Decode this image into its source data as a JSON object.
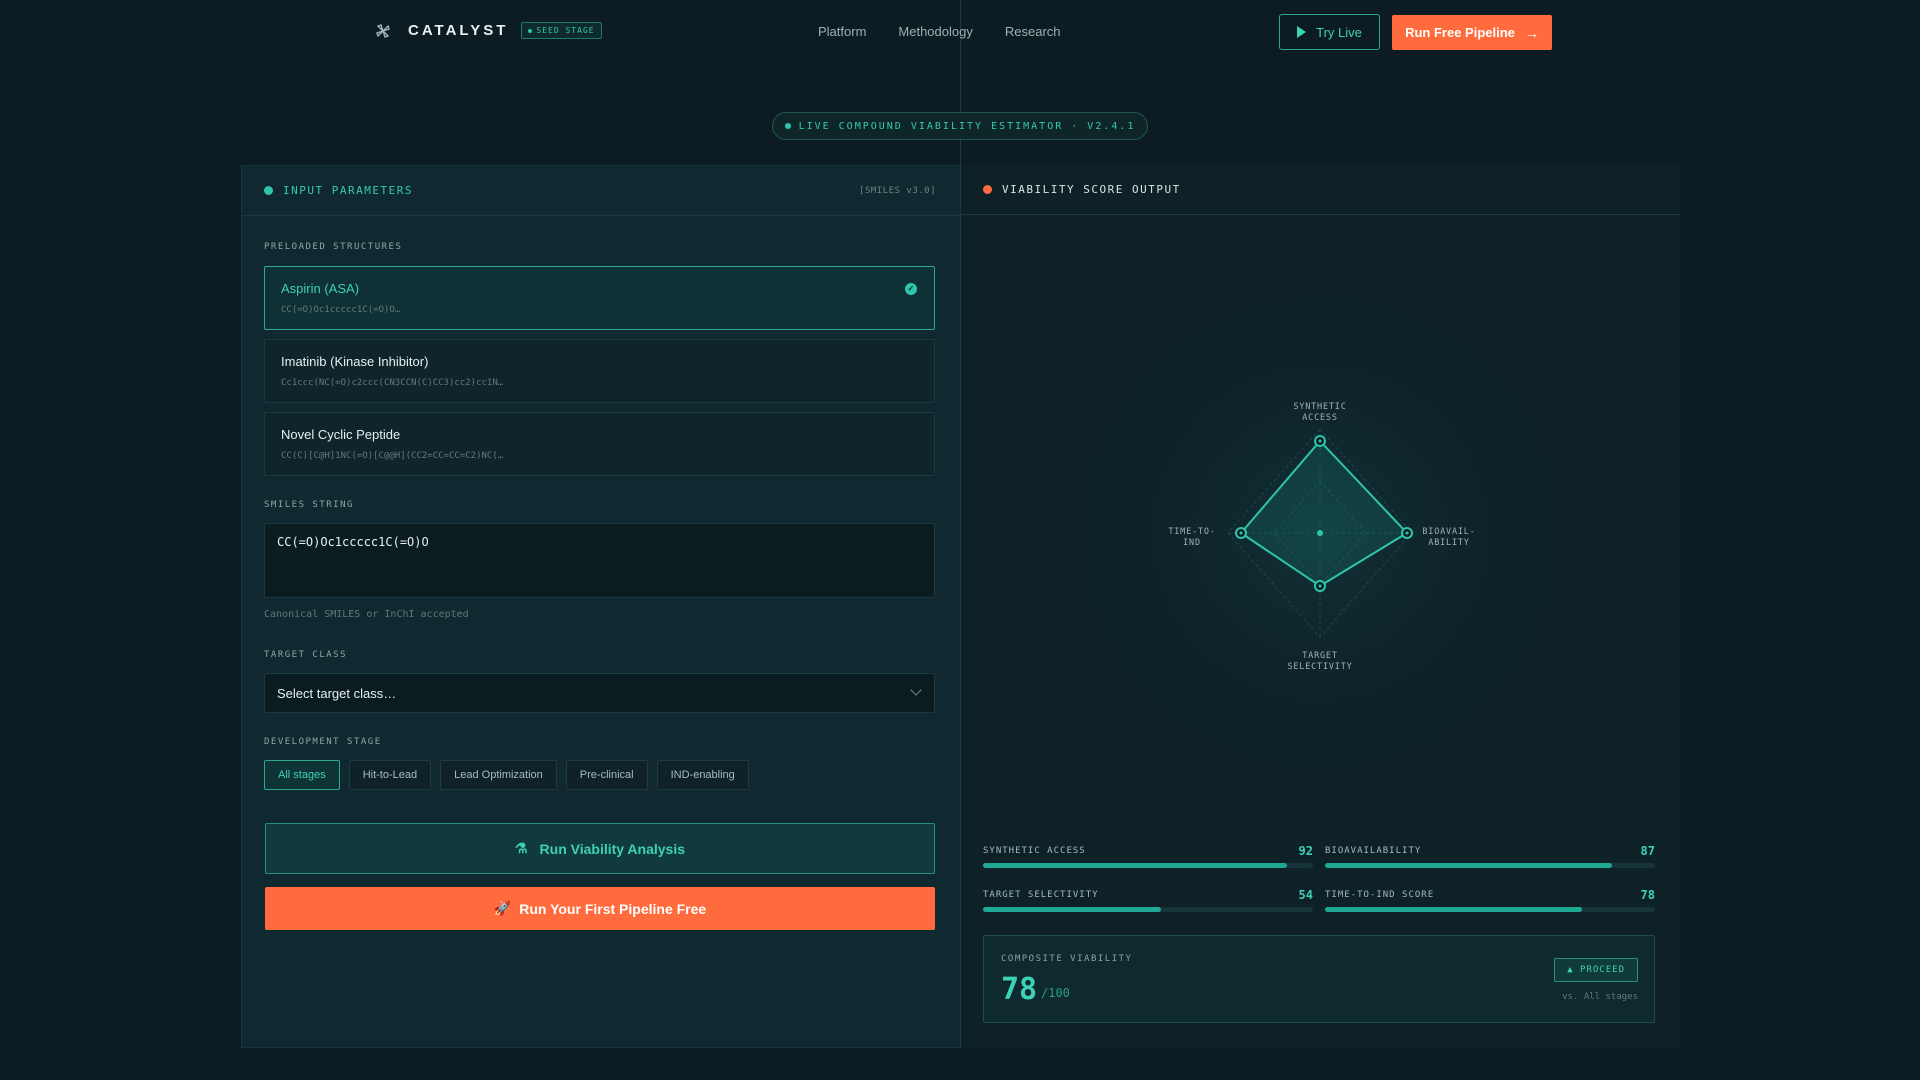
{
  "nav": {
    "brand": "CATALYST",
    "badge": "SEED STAGE",
    "links": [
      "Platform",
      "Methodology",
      "Research"
    ],
    "try_label": "Try Live",
    "run_label": "Run Free Pipeline"
  },
  "hero": {
    "pill": "LIVE COMPOUND VIABILITY ESTIMATOR · V2.4.1"
  },
  "input_panel": {
    "title": "INPUT PARAMETERS",
    "version": "[SMILES v3.0]",
    "preloaded_label": "PRELOADED STRUCTURES",
    "structures": [
      {
        "name": "Aspirin (ASA)",
        "smiles": "CC(=O)Oc1ccccc1C(=O)O…",
        "selected": true
      },
      {
        "name": "Imatinib (Kinase Inhibitor)",
        "smiles": "Cc1ccc(NC(=O)c2ccc(CN3CCN(C)CC3)cc2)cc1N…",
        "selected": false
      },
      {
        "name": "Novel Cyclic Peptide",
        "smiles": "CC(C)[C@H]1NC(=O)[C@@H](CC2=CC=CC=C2)NC(…",
        "selected": false
      }
    ],
    "smiles_label": "SMILES STRING",
    "smiles_value": "CC(=O)Oc1ccccc1C(=O)O",
    "smiles_hint": "Canonical SMILES or InChI accepted",
    "target_label": "TARGET CLASS",
    "target_placeholder": "Select target class…",
    "stage_label": "DEVELOPMENT STAGE",
    "stages": [
      "All stages",
      "Hit-to-Lead",
      "Lead Optimization",
      "Pre-clinical",
      "IND-enabling"
    ],
    "active_stage": "All stages",
    "analyze_label": "Run Viability Analysis",
    "pipeline_label": "Run Your First Pipeline Free"
  },
  "output_panel": {
    "title": "VIABILITY SCORE OUTPUT",
    "radar_axes": {
      "top": [
        "SYNTHETIC",
        "ACCESS"
      ],
      "right": [
        "BIOAVAIL-",
        "ABILITY"
      ],
      "bottom": [
        "TARGET",
        "SELECTIVITY"
      ],
      "left": [
        "TIME-TO-",
        "IND"
      ]
    },
    "metrics": [
      {
        "name": "SYNTHETIC ACCESS",
        "value": 92
      },
      {
        "name": "BIOAVAILABILITY",
        "value": 87
      },
      {
        "name": "TARGET SELECTIVITY",
        "value": 54
      },
      {
        "name": "TIME-TO-IND SCORE",
        "value": 78
      }
    ],
    "composite_label": "COMPOSITE VIABILITY",
    "composite_score": "78",
    "composite_denom": "/100",
    "proceed_label": "▲ PROCEED",
    "vs_label": "vs. All stages"
  },
  "colors": {
    "accent": "#2fc5ad",
    "cta": "#ff6b3d",
    "background": "#0c1c22"
  }
}
